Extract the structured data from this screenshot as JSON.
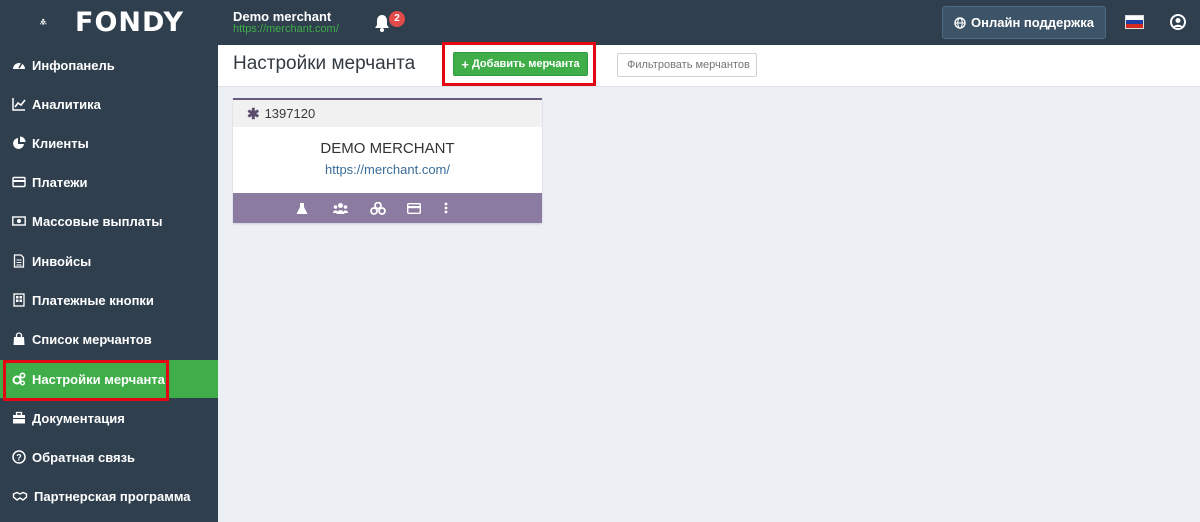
{
  "brand": {
    "logo_text": "FONDY"
  },
  "header": {
    "merchant_name": "Demo merchant",
    "merchant_url": "https://merchant.com/",
    "notifications_count": "2",
    "support_label": "Онлайн поддержка"
  },
  "sidebar": {
    "items": [
      {
        "label": "Инфопанель",
        "icon": "dashboard-icon"
      },
      {
        "label": "Аналитика",
        "icon": "chart-line-icon"
      },
      {
        "label": "Клиенты",
        "icon": "pie-chart-icon"
      },
      {
        "label": "Платежи",
        "icon": "credit-card-icon"
      },
      {
        "label": "Массовые выплаты",
        "icon": "money-icon"
      },
      {
        "label": "Инвойсы",
        "icon": "file-text-icon"
      },
      {
        "label": "Платежные кнопки",
        "icon": "buttons-icon"
      },
      {
        "label": "Список мерчантов",
        "icon": "bag-icon"
      },
      {
        "label": "Настройки мерчанта",
        "icon": "cogs-icon",
        "active": true
      },
      {
        "label": "Документация",
        "icon": "briefcase-icon"
      },
      {
        "label": "Обратная связь",
        "icon": "question-circle-icon"
      },
      {
        "label": "Партнерская программа",
        "icon": "handshake-icon"
      }
    ]
  },
  "page": {
    "title": "Настройки мерчанта",
    "add_button": "Добавить мерчанта",
    "filter_placeholder": "Фильтровать мерчантов"
  },
  "card": {
    "id": "1397120",
    "name": "DEMO MERCHANT",
    "url": "https://merchant.com/",
    "actions": [
      "flask-icon",
      "users-icon",
      "cubes-icon",
      "credit-card-icon",
      "more-vertical-icon"
    ]
  },
  "colors": {
    "sidebar_bg": "#2f3f4e",
    "accent_green": "#3fae49",
    "card_footer": "#8c7ba0",
    "highlight_red": "#e30613"
  }
}
